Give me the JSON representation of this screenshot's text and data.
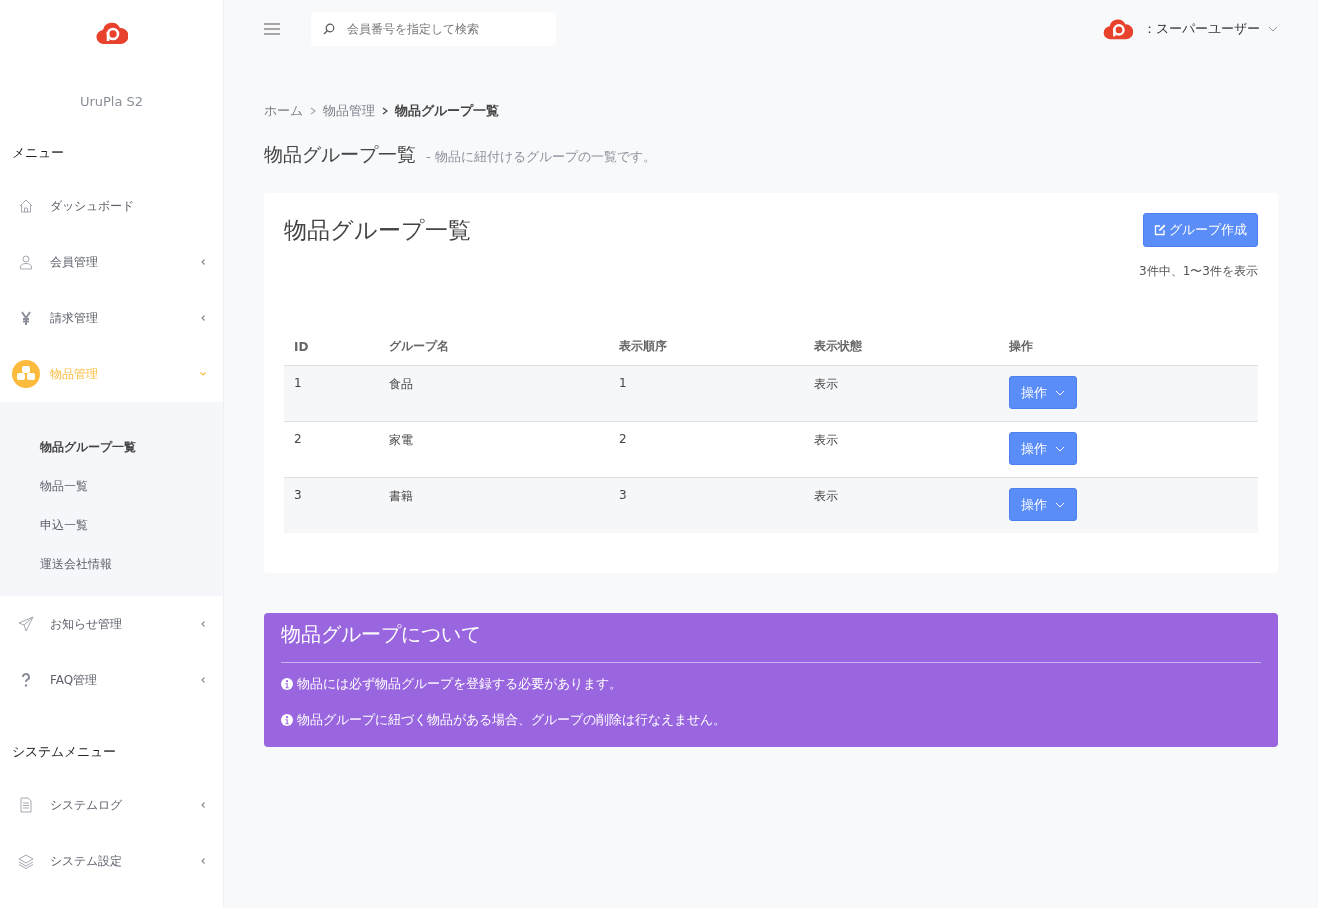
{
  "sidebar": {
    "brand": "UruPla S2",
    "sections": [
      {
        "title": "メニュー",
        "items": [
          {
            "label": "ダッシュボード",
            "kind": "link",
            "selected": false
          },
          {
            "label": "会員管理",
            "kind": "group",
            "expanded": false,
            "selected": false
          },
          {
            "label": "請求管理",
            "kind": "group",
            "expanded": false,
            "selected": false
          },
          {
            "label": "物品管理",
            "kind": "group",
            "expanded": true,
            "selected": true,
            "children": [
              {
                "label": "物品グループ一覧",
                "selected": true
              },
              {
                "label": "物品一覧",
                "selected": false
              },
              {
                "label": "申込一覧",
                "selected": false
              },
              {
                "label": "運送会社情報",
                "selected": false
              }
            ]
          },
          {
            "label": "お知らせ管理",
            "kind": "group",
            "expanded": false,
            "selected": false
          },
          {
            "label": "FAQ管理",
            "kind": "group",
            "expanded": false,
            "selected": false
          }
        ]
      },
      {
        "title": "システムメニュー",
        "items": [
          {
            "label": "システムログ",
            "kind": "group",
            "expanded": false,
            "selected": false
          },
          {
            "label": "システム設定",
            "kind": "group",
            "expanded": false,
            "selected": false
          }
        ]
      }
    ]
  },
  "header": {
    "search": {
      "placeholder": "会員番号を指定して検索"
    },
    "user": "：スーパーユーザー"
  },
  "breadcrumb": [
    "ホーム",
    "物品管理",
    "物品グループ一覧"
  ],
  "page": {
    "title": "物品グループ一覧",
    "subtitle": "- 物品に紐付けるグループの一覧です。"
  },
  "card": {
    "title": "物品グループ一覧",
    "create_button": "グループ作成",
    "count": "3件中、1〜3件を表示",
    "table": {
      "columns": [
        "ID",
        "グループ名",
        "表示順序",
        "表示状態",
        "操作"
      ],
      "rows": [
        {
          "id": "1",
          "name": "食品",
          "order": "1",
          "status": "表示",
          "action": "操作"
        },
        {
          "id": "2",
          "name": "家電",
          "order": "2",
          "status": "表示",
          "action": "操作"
        },
        {
          "id": "3",
          "name": "書籍",
          "order": "3",
          "status": "表示",
          "action": "操作"
        }
      ]
    }
  },
  "info": {
    "title": "物品グループについて",
    "notes": [
      "物品には必ず物品グループを登録する必要があります。",
      "物品グループに紐づく物品がある場合、グループの削除は行なえません。"
    ]
  }
}
